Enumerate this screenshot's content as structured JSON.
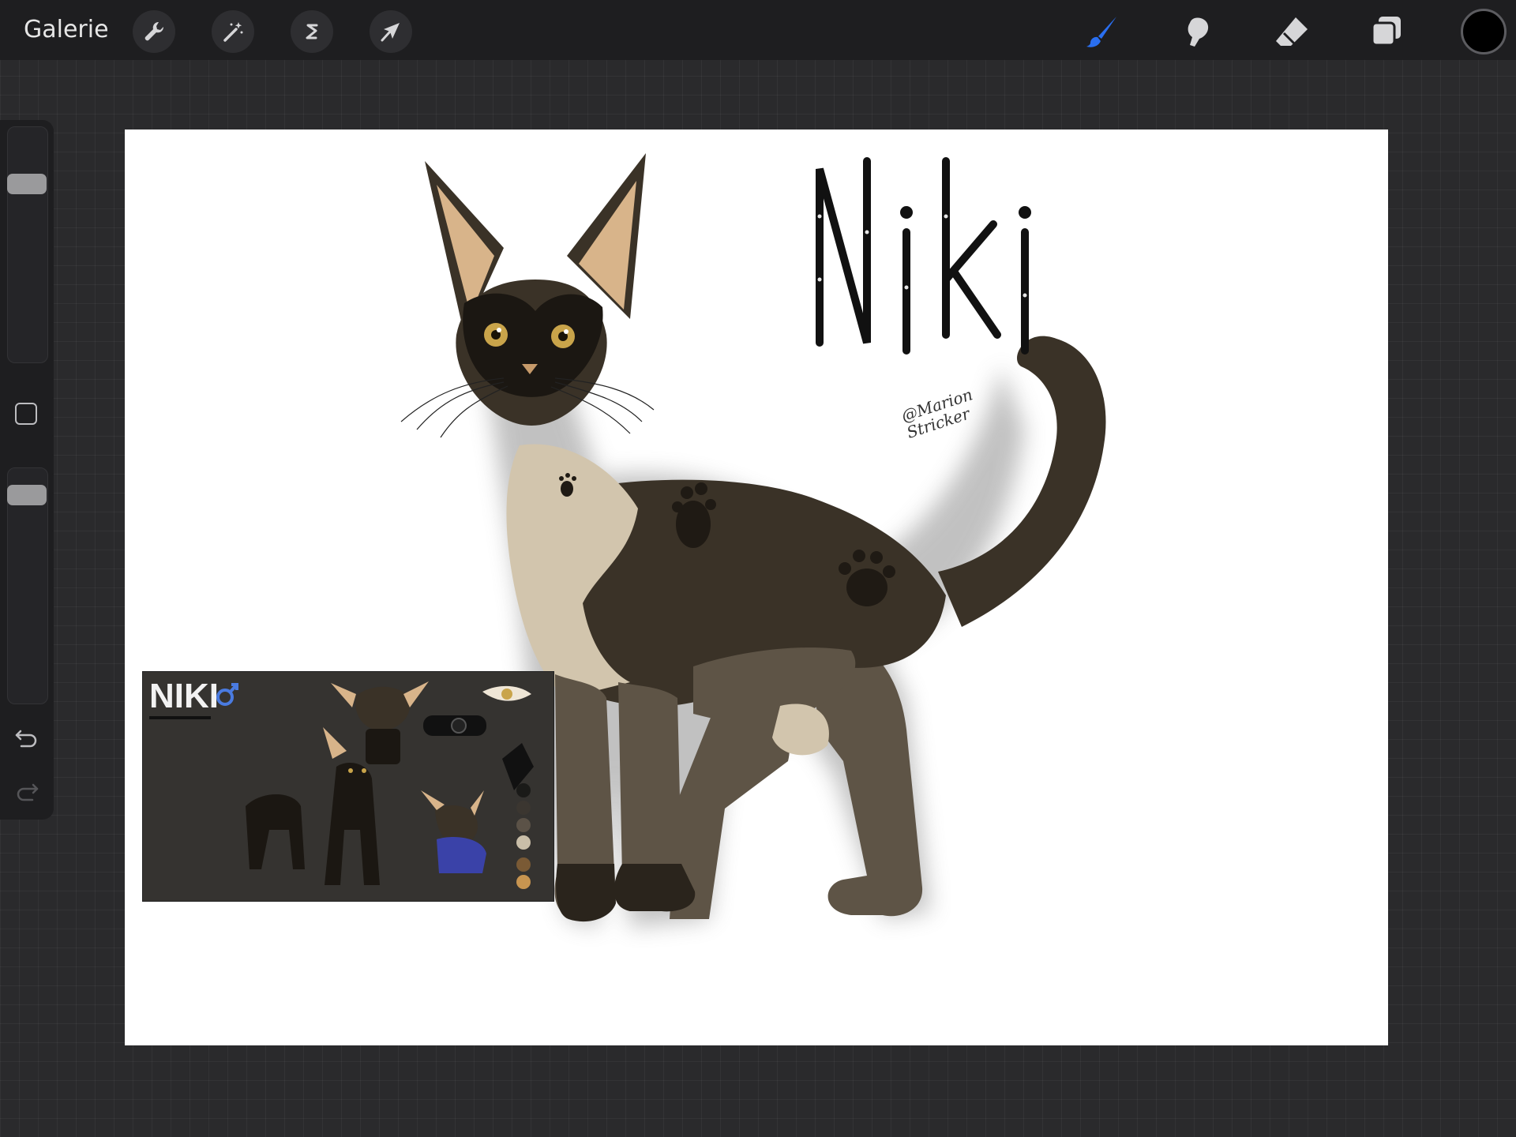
{
  "topbar": {
    "gallery_label": "Galerie",
    "left_tools": [
      {
        "name": "actions",
        "icon": "wrench-icon"
      },
      {
        "name": "adjustments",
        "icon": "magic-wand-icon"
      },
      {
        "name": "selection",
        "icon": "selection-s-icon"
      },
      {
        "name": "transform",
        "icon": "arrow-cursor-icon"
      }
    ],
    "right_tools": [
      {
        "name": "brush",
        "icon": "brush-icon",
        "active": true
      },
      {
        "name": "smudge",
        "icon": "smudge-finger-icon"
      },
      {
        "name": "eraser",
        "icon": "eraser-icon"
      },
      {
        "name": "layers",
        "icon": "layers-icon"
      }
    ],
    "current_color": "#000000",
    "active_color": "#2a6ff0"
  },
  "sidebar": {
    "brush_size_level": 0.78,
    "opacity_level": 0.92,
    "modify_icon": "square-icon",
    "undo_icon": "undo-icon",
    "redo_icon": "redo-icon"
  },
  "artwork": {
    "ref_sheet_title": "NIKI",
    "ref_sheet_gender_icon": "male-symbol-icon",
    "name_lettering": "Niki",
    "signature": "@Marion Stricker",
    "palette": [
      "#1a1a18",
      "#3b3630",
      "#5b5247",
      "#c9bea8",
      "#7a5a35",
      "#c89550"
    ],
    "main_colors": {
      "fur_dark": "#3a3227",
      "fur_mid": "#5e5446",
      "fur_cream": "#d2c5ad",
      "ear_inner": "#d8b48a",
      "eye": "#c9a44a"
    }
  }
}
